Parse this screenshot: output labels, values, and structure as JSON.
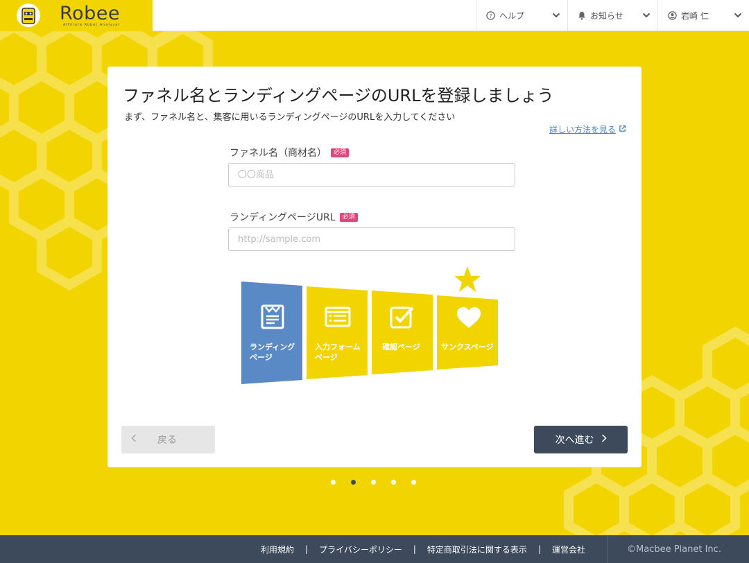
{
  "header": {
    "logo_text": "Robee",
    "logo_sub": "Affiliate Robot Analyzer",
    "nav": [
      {
        "label": "ヘルプ",
        "icon": "question-circle-icon"
      },
      {
        "label": "お知らせ",
        "icon": "bell-icon"
      },
      {
        "label": "岩崎 仁",
        "icon": "user-circle-icon"
      }
    ]
  },
  "card": {
    "title": "ファネル名とランディングページのURLを登録しましょう",
    "subtitle": "まず、ファネル名と、集客に用いるランディングページのURLを入力してください",
    "help_link": "詳しい方法を見る",
    "funnel_name": {
      "label": "ファネル名（商材名）",
      "required": "必須",
      "placeholder": "〇〇商品",
      "value": ""
    },
    "lp_url": {
      "label": "ランディングページURL",
      "required": "必須",
      "placeholder": "http://sample.com",
      "value": ""
    },
    "funnel_stages": [
      {
        "label_line1": "ランディング",
        "label_line2": "ページ",
        "icon": "document-icon",
        "active": true
      },
      {
        "label_line1": "入力フォーム",
        "label_line2": "ページ",
        "icon": "form-list-icon",
        "active": false
      },
      {
        "label_line1": "確認ページ",
        "label_line2": "",
        "icon": "checkbox-icon",
        "active": false
      },
      {
        "label_line1": "サンクスページ",
        "label_line2": "",
        "icon": "heart-icon",
        "active": false
      }
    ],
    "back_label": "戻る",
    "next_label": "次へ進む"
  },
  "pagination": {
    "total": 5,
    "current": 2
  },
  "footer": {
    "links": [
      "利用規約",
      "プライバシーポリシー",
      "特定商取引法に関する表示",
      "運営会社"
    ],
    "copyright": "©Macbee Planet Inc."
  },
  "colors": {
    "brand_yellow": "#f2d500",
    "active_stage": "#5a8ac6",
    "dark_navy": "#3d4a5c",
    "required_badge": "#e0457b"
  }
}
